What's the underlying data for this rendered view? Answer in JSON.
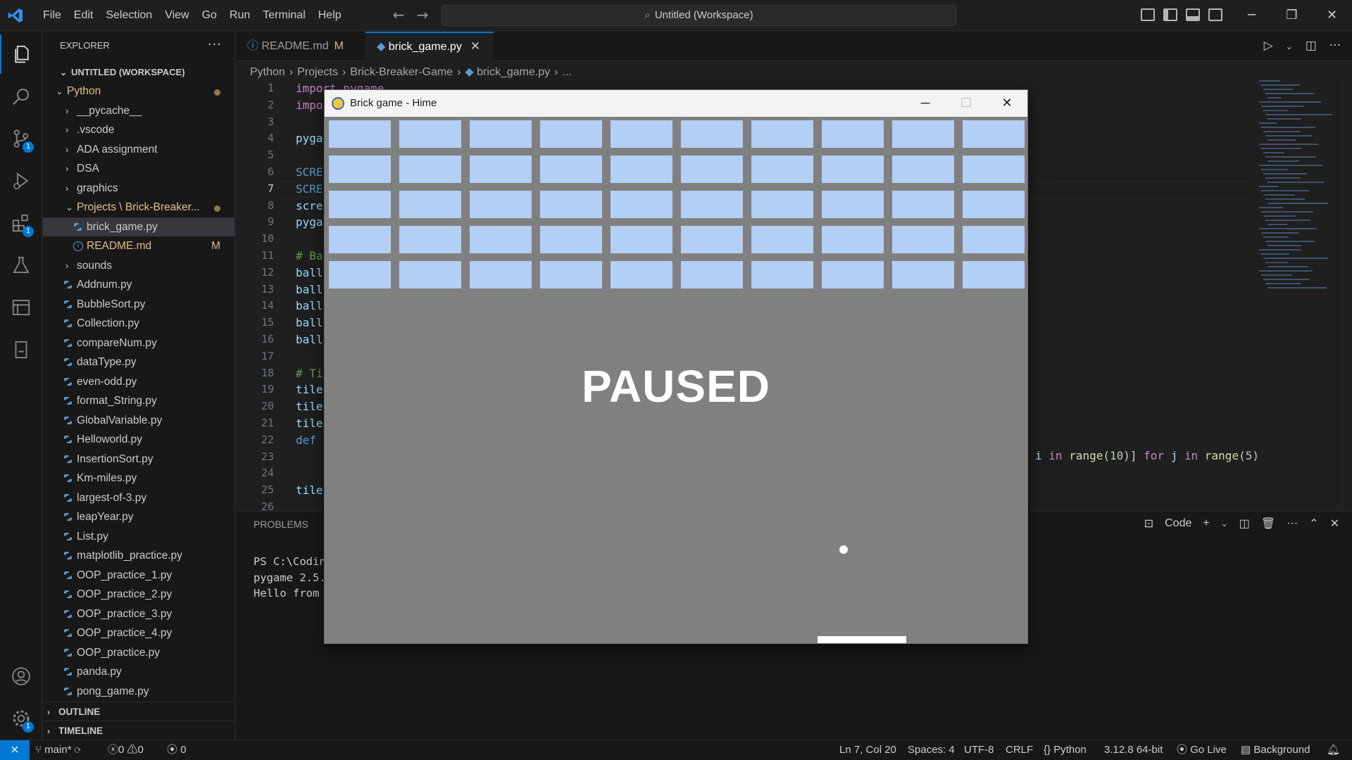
{
  "menu": [
    "File",
    "Edit",
    "Selection",
    "View",
    "Go",
    "Run",
    "Terminal",
    "Help"
  ],
  "command_center": "Untitled (Workspace)",
  "activity_badges": {
    "source_control": "1",
    "extensions": "1",
    "accounts_settings": "1"
  },
  "sidebar": {
    "header": "EXPLORER",
    "workspace": "UNTITLED (WORKSPACE)",
    "outline": "OUTLINE",
    "timeline": "TIMELINE"
  },
  "tree": [
    {
      "label": "Python",
      "type": "folder-open",
      "indent": 0,
      "color": "#e2c08d",
      "dot": true
    },
    {
      "label": "__pycache__",
      "type": "folder",
      "indent": 1
    },
    {
      "label": ".vscode",
      "type": "folder",
      "indent": 1
    },
    {
      "label": "ADA assignment",
      "type": "folder",
      "indent": 1
    },
    {
      "label": "DSA",
      "type": "folder",
      "indent": 1
    },
    {
      "label": "graphics",
      "type": "folder",
      "indent": 1
    },
    {
      "label": "Projects \\ Brick-Breaker...",
      "type": "folder-open",
      "indent": 1,
      "color": "#e2c08d",
      "dot": true
    },
    {
      "label": "brick_game.py",
      "type": "py",
      "indent": 2,
      "selected": true
    },
    {
      "label": "README.md",
      "type": "info",
      "indent": 2,
      "color": "#e2c08d",
      "flag": "M"
    },
    {
      "label": "sounds",
      "type": "folder",
      "indent": 1
    },
    {
      "label": "Addnum.py",
      "type": "py",
      "indent": 1
    },
    {
      "label": "BubbleSort.py",
      "type": "py",
      "indent": 1
    },
    {
      "label": "Collection.py",
      "type": "py",
      "indent": 1
    },
    {
      "label": "compareNum.py",
      "type": "py",
      "indent": 1
    },
    {
      "label": "dataType.py",
      "type": "py",
      "indent": 1
    },
    {
      "label": "even-odd.py",
      "type": "py",
      "indent": 1
    },
    {
      "label": "format_String.py",
      "type": "py",
      "indent": 1
    },
    {
      "label": "GlobalVariable.py",
      "type": "py",
      "indent": 1
    },
    {
      "label": "Helloworld.py",
      "type": "py",
      "indent": 1
    },
    {
      "label": "InsertionSort.py",
      "type": "py",
      "indent": 1
    },
    {
      "label": "Km-miles.py",
      "type": "py",
      "indent": 1
    },
    {
      "label": "largest-of-3.py",
      "type": "py",
      "indent": 1
    },
    {
      "label": "leapYear.py",
      "type": "py",
      "indent": 1
    },
    {
      "label": "List.py",
      "type": "py",
      "indent": 1
    },
    {
      "label": "matplotlib_practice.py",
      "type": "py",
      "indent": 1
    },
    {
      "label": "OOP_practice_1.py",
      "type": "py",
      "indent": 1
    },
    {
      "label": "OOP_practice_2.py",
      "type": "py",
      "indent": 1
    },
    {
      "label": "OOP_practice_3.py",
      "type": "py",
      "indent": 1
    },
    {
      "label": "OOP_practice_4.py",
      "type": "py",
      "indent": 1
    },
    {
      "label": "OOP_practice.py",
      "type": "py",
      "indent": 1
    },
    {
      "label": "panda.py",
      "type": "py",
      "indent": 1
    },
    {
      "label": "pong_game.py",
      "type": "py",
      "indent": 1
    }
  ],
  "tabs": {
    "readme": {
      "label": "README.md",
      "flag": "M"
    },
    "brick": {
      "label": "brick_game.py",
      "close": "✕"
    }
  },
  "breadcrumb": [
    "Python",
    "Projects",
    "Brick-Breaker-Game",
    "brick_game.py",
    "..."
  ],
  "line_numbers": [
    "1",
    "2",
    "3",
    "4",
    "5",
    "6",
    "7",
    "8",
    "9",
    "10",
    "11",
    "12",
    "13",
    "14",
    "15",
    "16",
    "17",
    "18",
    "19",
    "20",
    "21",
    "22",
    "23",
    "24",
    "25",
    "26"
  ],
  "current_line": "7",
  "code_lines": [
    {
      "t": "import pygame",
      "c": "k"
    },
    {
      "t": "impo",
      "c": "k"
    },
    {
      "t": "",
      "c": ""
    },
    {
      "t": "pyga",
      "c": "v"
    },
    {
      "t": "",
      "c": ""
    },
    {
      "t": "SCRE",
      "c": ""
    },
    {
      "t": "SCRE",
      "c": ""
    },
    {
      "t": "scre",
      "c": "v"
    },
    {
      "t": "pyga",
      "c": "v"
    },
    {
      "t": "",
      "c": ""
    },
    {
      "t": "# Ba",
      "c": "c"
    },
    {
      "t": "ball",
      "c": "v"
    },
    {
      "t": "ball",
      "c": "v"
    },
    {
      "t": "ball",
      "c": "v"
    },
    {
      "t": "ball",
      "c": "v"
    },
    {
      "t": "ball",
      "c": "v"
    },
    {
      "t": "",
      "c": ""
    },
    {
      "t": "# Ti",
      "c": "c"
    },
    {
      "t": "tile",
      "c": "v"
    },
    {
      "t": "tile",
      "c": "v"
    },
    {
      "t": "tile",
      "c": "v"
    },
    {
      "t": "def",
      "c": ""
    },
    {
      "t": "",
      "c": ""
    },
    {
      "t": "",
      "c": ""
    },
    {
      "t": "tile",
      "c": "v"
    },
    {
      "t": "",
      "c": ""
    }
  ],
  "code_right_line": {
    "a": "i",
    "b": "in",
    "c": "range",
    "d": "(",
    "e": "10",
    "f": ")]",
    "g": "for",
    "h": "j",
    "i": "in",
    "j": "range",
    "k": "(",
    "l": "5)"
  },
  "panel": {
    "tab": "PROBLEMS",
    "terminal_name": "Code",
    "terminal_lines": [
      "PS C:\\Codin",
      "pygame 2.5.",
      "Hello from "
    ]
  },
  "status": {
    "branch": "main*",
    "errors": "0",
    "warnings": "0",
    "ports": "0",
    "position": "Ln 7, Col 20",
    "spaces": "Spaces: 4",
    "encoding": "UTF-8",
    "eol": "CRLF",
    "language": "Python",
    "interpreter": "3.12.8 64-bit",
    "golive": "Go Live",
    "background": "Background"
  },
  "game": {
    "title": "Brick game - Hime",
    "paused_text": "PAUSED",
    "brick_rows": 5,
    "brick_cols": 10,
    "brick_color": "#b3cff5",
    "background_color": "#808080"
  },
  "colors": {
    "accent": "#0078d4",
    "modified": "#d7ba7d"
  }
}
